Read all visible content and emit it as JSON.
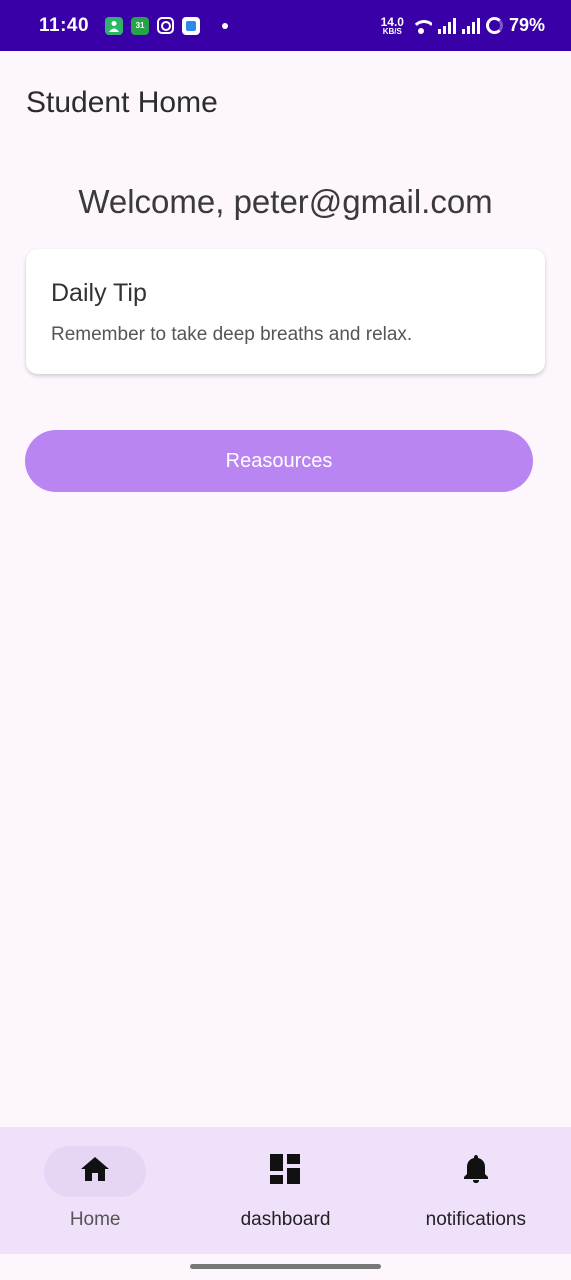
{
  "status_bar": {
    "time": "11:40",
    "net_speed_value": "14.0",
    "net_speed_unit": "KB/S",
    "battery": "79%",
    "notification_icons": [
      "contacts-icon",
      "calendar-icon",
      "instagram-icon",
      "files-icon"
    ],
    "calendar_icon_text": "31"
  },
  "header": {
    "title": "Student Home"
  },
  "main": {
    "welcome": "Welcome, peter@gmail.com",
    "daily_tip": {
      "title": "Daily Tip",
      "text": "Remember to take deep breaths and relax."
    },
    "resources_button": "Reasources"
  },
  "bottom_nav": {
    "items": [
      {
        "label": "Home",
        "icon": "home-icon",
        "active": true
      },
      {
        "label": "dashboard",
        "icon": "dashboard-icon",
        "active": false
      },
      {
        "label": "notifications",
        "icon": "bell-icon",
        "active": false
      }
    ]
  },
  "colors": {
    "status_bar": "#3a00a8",
    "background": "#fdf6fd",
    "accent_button": "#b985f3",
    "nav_background": "#f0e1fb"
  }
}
